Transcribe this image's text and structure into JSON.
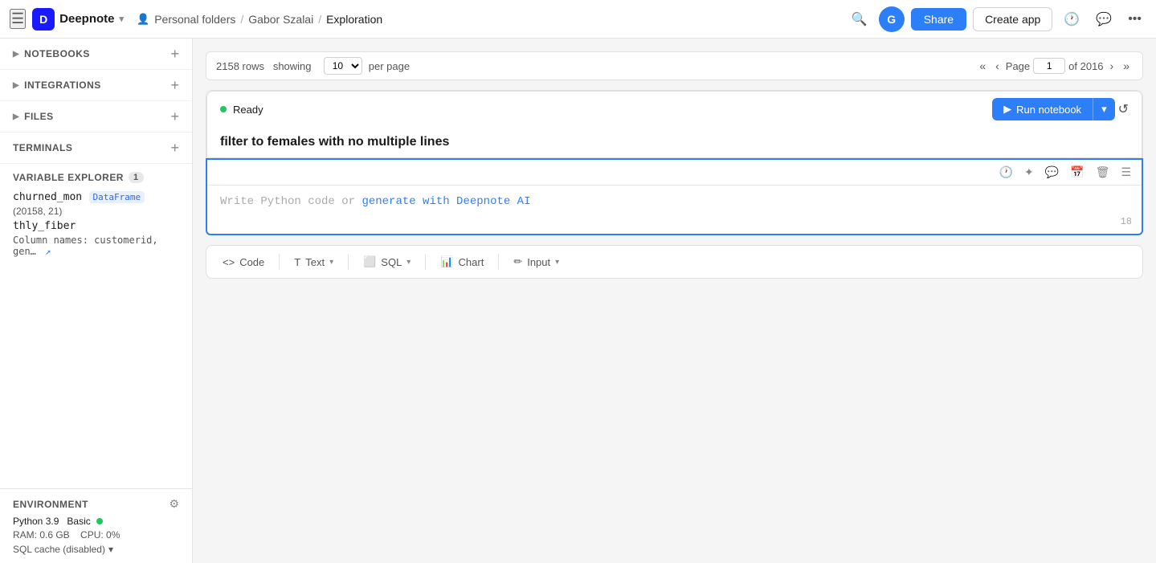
{
  "header": {
    "logo_text": "Deepnote",
    "menu_icon": "☰",
    "breadcrumb": {
      "personal_folders": "Personal folders",
      "separator1": "/",
      "author": "Gabor Szalai",
      "separator2": "/",
      "current": "Exploration"
    },
    "share_label": "Share",
    "create_app_label": "Create app",
    "avatar_letter": "G"
  },
  "sidebar": {
    "notebooks_label": "NOTEBOOKS",
    "integrations_label": "INTEGRATIONS",
    "files_label": "FILES",
    "terminals_label": "TERMINALS",
    "variable_explorer_label": "VARIABLE EXPLORER",
    "variable_count": "1",
    "variables": [
      {
        "name": "churned_mon",
        "type": "DataFrame",
        "shape": "(20158, 21)"
      },
      {
        "name": "thly_fiber",
        "type": "",
        "shape": ""
      }
    ],
    "columns_label": "Column names: customerid, gen…"
  },
  "environment": {
    "title": "ENVIRONMENT",
    "python_version": "Python 3.9",
    "tier": "Basic",
    "ram": "RAM: 0.6 GB",
    "cpu": "CPU: 0%",
    "sql_cache": "SQL cache (disabled)"
  },
  "pagination": {
    "rows_label": "2158 rows  showing",
    "per_page": "10",
    "per_page_label": "per page",
    "page_label": "Page",
    "current_page": "1",
    "total_pages": "of 2016"
  },
  "status_bar": {
    "status": "Ready",
    "run_notebook_label": "Run notebook",
    "play_icon": "▶"
  },
  "cell": {
    "title": "filter to females with no multiple lines",
    "placeholder": "Write Python code or ",
    "placeholder_link": "generate with Deepnote AI",
    "line_count": "18"
  },
  "toolbar_icons": {
    "clock": "🕐",
    "magic": "✦",
    "comment": "💬",
    "calendar": "📅",
    "trash": "🗑",
    "list": "☰"
  },
  "add_block": {
    "code_label": "Code",
    "text_label": "Text",
    "sql_label": "SQL",
    "chart_label": "Chart",
    "input_label": "Input"
  }
}
